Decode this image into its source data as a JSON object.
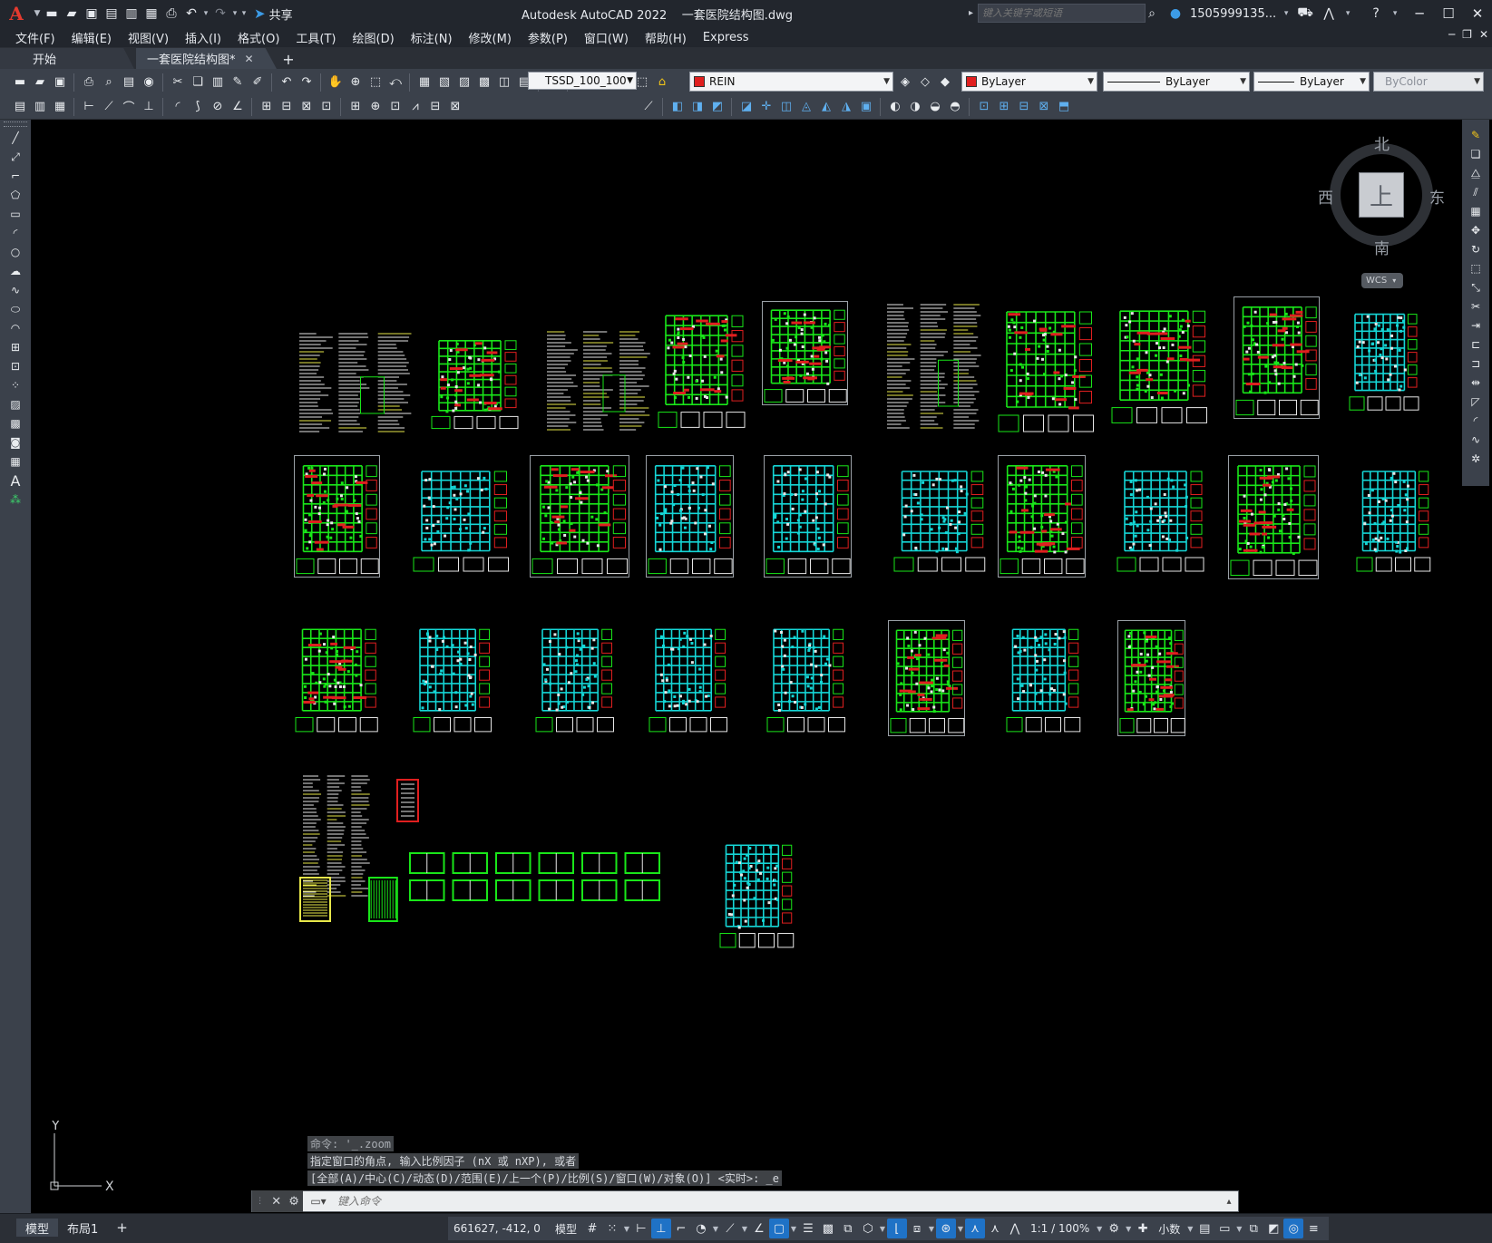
{
  "app": {
    "window_title": "Autodesk AutoCAD 2022    一套医院结构图.dwg",
    "logo": "A",
    "share_label": "共享",
    "search_placeholder": "键入关键字或短语",
    "username": "1505999135...",
    "icon_names": [
      "new-icon",
      "open-icon",
      "save-icon",
      "saveas-icon",
      "publish-icon",
      "plot-icon",
      "undo-icon",
      "redo-icon",
      "share-icon",
      "search-icon",
      "user-icon",
      "cart-icon",
      "autodesk-icon",
      "help-icon"
    ]
  },
  "menu": {
    "items": [
      "文件(F)",
      "编辑(E)",
      "视图(V)",
      "插入(I)",
      "格式(O)",
      "工具(T)",
      "绘图(D)",
      "标注(N)",
      "修改(M)",
      "参数(P)",
      "窗口(W)",
      "帮助(H)",
      "Express"
    ]
  },
  "tabs": {
    "start_label": "开始",
    "file_label": "一套医院结构图*"
  },
  "toolbar": {
    "layer_name": "REIN",
    "layer_color": "#e01f1f",
    "color_value": "ByLayer",
    "linetype_value": "ByLayer",
    "lineweight_value": "ByLayer",
    "plotstyle_value": "ByColor",
    "dim_style": "TSSD_100_100"
  },
  "viewcube": {
    "face": "上",
    "north": "北",
    "south": "南",
    "west": "西",
    "east": "东",
    "wcs": "WCS"
  },
  "ucs": {
    "x_label": "X",
    "y_label": "Y"
  },
  "command": {
    "history": [
      "命令: '_.zoom",
      "指定窗口的角点, 输入比例因子 (nX 或 nXP), 或者",
      "[全部(A)/中心(C)/动态(D)/范围(E)/上一个(P)/比例(S)/窗口(W)/对象(O)] <实时>: _e"
    ],
    "placeholder": "键入命令"
  },
  "status": {
    "layout_tabs": [
      "模型",
      "布局1"
    ],
    "coordinates": "661627, -412, 0",
    "model_label": "模型",
    "scale_label": "1:1 / 100%",
    "units_label": "小数"
  },
  "colors": {
    "accent": "#1f72c6",
    "drawing_green": "#19e619",
    "drawing_cyan": "#15d6d6",
    "drawing_red": "#e01f1f"
  }
}
